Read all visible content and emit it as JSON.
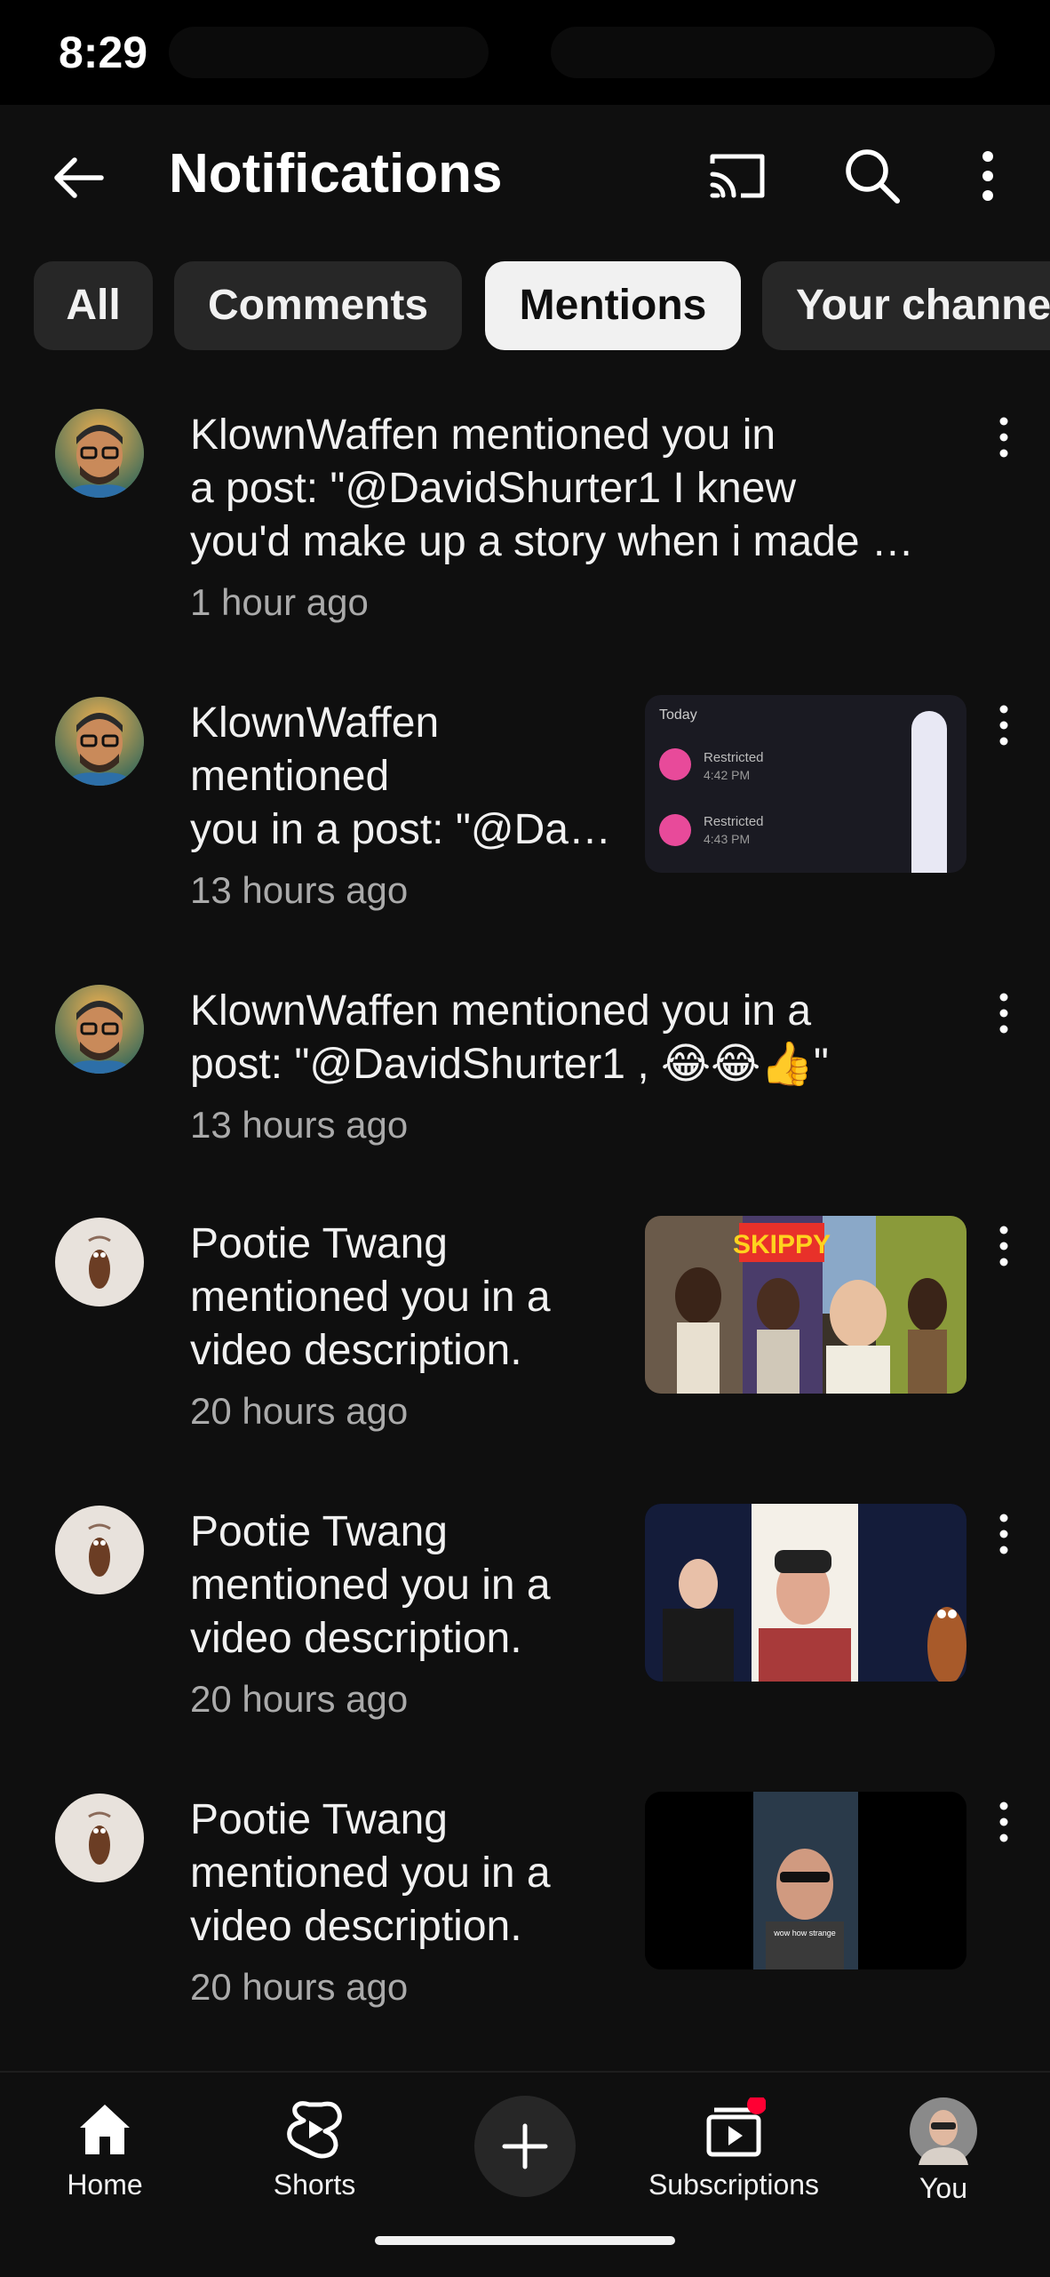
{
  "status_bar": {
    "time": "8:29"
  },
  "app_bar": {
    "title": "Notifications",
    "icons": [
      "back-arrow-icon",
      "cast-icon",
      "search-icon",
      "more-vert-icon"
    ]
  },
  "chips": [
    {
      "label": "All",
      "selected": false
    },
    {
      "label": "Comments",
      "selected": false
    },
    {
      "label": "Mentions",
      "selected": true
    },
    {
      "label": "Your channe",
      "selected": false
    }
  ],
  "notifications": [
    {
      "lines": [
        "KlownWaffen mentioned you in",
        "a post: \"@DavidShurter1  I knew",
        "you'd make up a story when i made …"
      ],
      "time": "1 hour ago",
      "avatar": "bitmoji-avatar",
      "thumbnail": "none"
    },
    {
      "lines": [
        "KlownWaffen",
        "mentioned",
        "you in a post: \"@Da…"
      ],
      "time": "13 hours ago",
      "avatar": "bitmoji-avatar",
      "thumbnail": "screenshot",
      "thumb_text": [
        "Today",
        "Restricted",
        "4:42 PM",
        "Restricted",
        "4:43 PM"
      ]
    },
    {
      "lines": [
        "KlownWaffen mentioned you in a",
        "post: \"@DavidShurter1 , 😂😂👍\""
      ],
      "time": "13 hours ago",
      "avatar": "bitmoji-avatar",
      "thumbnail": "none"
    },
    {
      "lines": [
        "Pootie Twang",
        "mentioned you in a",
        "video description."
      ],
      "time": "20 hours ago",
      "avatar": "pootie-avatar",
      "thumbnail": "collage",
      "thumb_text": [
        "SKIPPY"
      ]
    },
    {
      "lines": [
        "Pootie Twang",
        "mentioned you in a",
        "video description."
      ],
      "time": "20 hours ago",
      "avatar": "pootie-avatar",
      "thumbnail": "stage"
    },
    {
      "lines": [
        "Pootie Twang",
        "mentioned you in a",
        "video description."
      ],
      "time": "20 hours ago",
      "avatar": "pootie-avatar",
      "thumbnail": "vertical-video",
      "thumb_text": [
        "wow how strange"
      ]
    }
  ],
  "bottom_nav": {
    "items": [
      {
        "label": "Home",
        "icon": "home-icon",
        "active": true
      },
      {
        "label": "Shorts",
        "icon": "shorts-icon",
        "active": false
      },
      {
        "label": "",
        "icon": "create-plus-icon",
        "active": false
      },
      {
        "label": "Subscriptions",
        "icon": "subscriptions-icon",
        "active": false,
        "badge": true
      },
      {
        "label": "You",
        "icon": "profile-avatar",
        "active": false
      }
    ]
  },
  "colors": {
    "background": "#0f0f0f",
    "chip": "#272727",
    "chip_selected": "#f1f1f1",
    "secondary_text": "#aaaaaa",
    "badge": "#ff0033"
  }
}
